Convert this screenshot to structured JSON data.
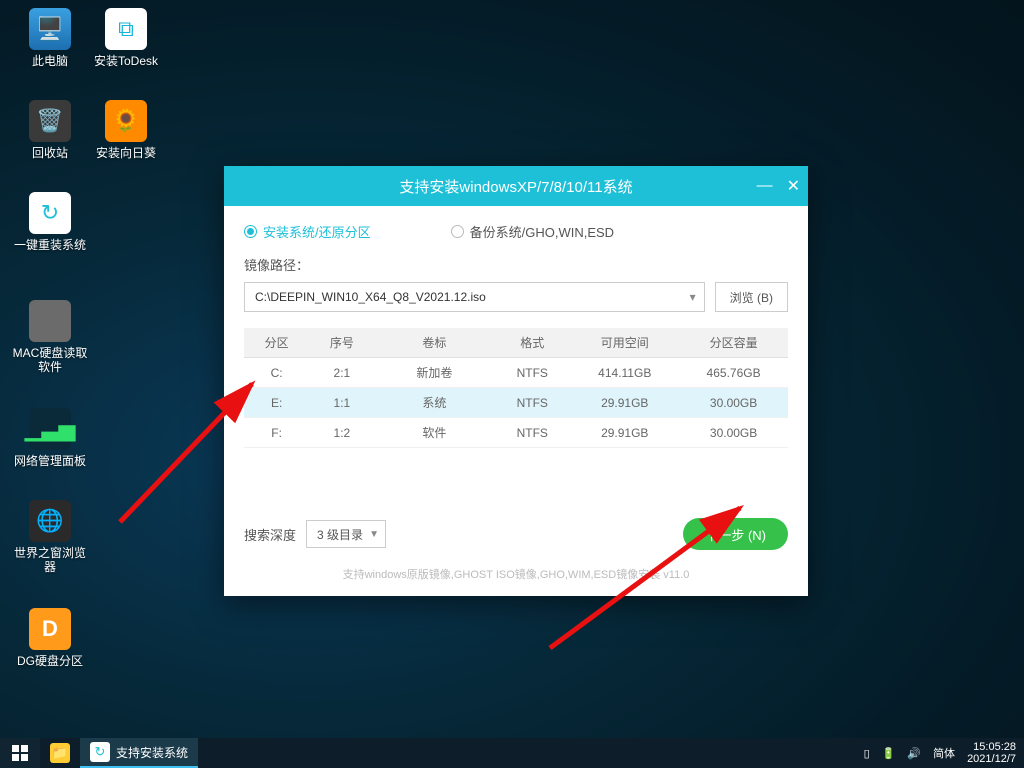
{
  "desktop": {
    "icons": [
      {
        "label": "此电脑"
      },
      {
        "label": "安装ToDesk"
      },
      {
        "label": "回收站"
      },
      {
        "label": "安装向日葵"
      },
      {
        "label": "一键重装系统"
      },
      {
        "label": "MAC硬盘读取软件"
      },
      {
        "label": "网络管理面板"
      },
      {
        "label": "世界之窗浏览器"
      },
      {
        "label": "DG硬盘分区"
      }
    ]
  },
  "window": {
    "title": "支持安装windowsXP/7/8/10/11系统",
    "mode_install": "安装系统/还原分区",
    "mode_backup": "备份系统/GHO,WIN,ESD",
    "image_path_label": "镜像路径：",
    "image_path": "C:\\DEEPIN_WIN10_X64_Q8_V2021.12.iso",
    "browse": "浏览 (B)",
    "columns": {
      "part": "分区",
      "index": "序号",
      "label": "卷标",
      "format": "格式",
      "free": "可用空间",
      "size": "分区容量"
    },
    "rows": [
      {
        "part": "C:",
        "index": "2:1",
        "label": "新加卷",
        "format": "NTFS",
        "free": "414.11GB",
        "size": "465.76GB"
      },
      {
        "part": "E:",
        "index": "1:1",
        "label": "系统",
        "format": "NTFS",
        "free": "29.91GB",
        "size": "30.00GB"
      },
      {
        "part": "F:",
        "index": "1:2",
        "label": "软件",
        "format": "NTFS",
        "free": "29.91GB",
        "size": "30.00GB"
      }
    ],
    "depth_label": "搜索深度",
    "depth_value": "3 级目录",
    "next": "下一步 (N)",
    "footnote": "支持windows原版镜像,GHOST ISO镜像,GHO,WIM,ESD镜像安装  v11.0"
  },
  "taskbar": {
    "app": "支持安装系统",
    "ime": "简体",
    "time": "15:05:28",
    "date": "2021/12/7"
  }
}
